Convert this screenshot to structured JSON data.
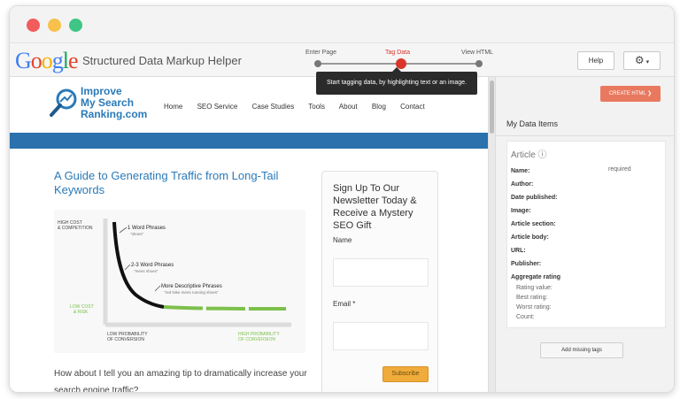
{
  "app": {
    "logo_letters": [
      {
        "ch": "G",
        "color": "#3f7ff1"
      },
      {
        "ch": "o",
        "color": "#e4432d"
      },
      {
        "ch": "o",
        "color": "#f4b400"
      },
      {
        "ch": "g",
        "color": "#3f7ff1"
      },
      {
        "ch": "l",
        "color": "#1aa260"
      },
      {
        "ch": "e",
        "color": "#e4432d"
      }
    ],
    "title": "Structured Data Markup Helper"
  },
  "steps": {
    "labels": [
      "Enter Page",
      "Tag Data",
      "View HTML"
    ],
    "active": 1,
    "tooltip": "Start tagging data, by highlighting text or an image."
  },
  "toolbar": {
    "help_label": "Help",
    "settings_icon": "gear-icon ▾"
  },
  "site": {
    "logo_lines": [
      "Improve",
      "My Search",
      "Ranking.com"
    ],
    "nav": [
      "Home",
      "SEO Service",
      "Case Studies",
      "Tools",
      "About",
      "Blog",
      "Contact"
    ],
    "article_title": "A Guide to Generating Traffic from Long-Tail Keywords",
    "intro": "How about I tell you an amazing tip to dramatically increase your search engine traffic?",
    "newsletter": {
      "title": "Sign Up To Our Newsletter Today & Receive a Mystery SEO Gift",
      "name_label": "Name",
      "email_label": "Email *",
      "subscribe_label": "Subscribe"
    }
  },
  "chart_data": {
    "type": "line",
    "axis_top_label_lines": [
      "HIGH COST",
      "& COMPETITION"
    ],
    "axis_left_low_lines": [
      "LOW COST",
      "& RISK"
    ],
    "axis_bottom_left_lines": [
      "LOW PROBABILITY",
      "OF CONVERSION"
    ],
    "axis_bottom_right_lines": [
      "HIGH PROBABILITY",
      "OF CONVERSION"
    ],
    "annotations": [
      {
        "label": "1 Word Phrases",
        "sub": "\"shoes\""
      },
      {
        "label": "2-3 Word Phrases",
        "sub": "\"mens shoes\""
      },
      {
        "label": "More Descriptive Phrases",
        "sub": "\"red Nike mens running shoes\""
      }
    ],
    "colors": {
      "head": "#111111",
      "tail": "#7cc04b"
    }
  },
  "panel": {
    "create_label": "CREATE HTML ❯",
    "title": "My Data Items",
    "section": "Article ⓘ",
    "required_label": "required",
    "fields": [
      "Name:",
      "Author:",
      "Date published:",
      "Image:",
      "Article section:",
      "Article body:",
      "URL:",
      "Publisher:",
      "Aggregate rating"
    ],
    "sub_fields": [
      "Rating value:",
      "Best rating:",
      "Worst rating:",
      "Count:"
    ],
    "add_missing_label": "Add missing tags"
  }
}
